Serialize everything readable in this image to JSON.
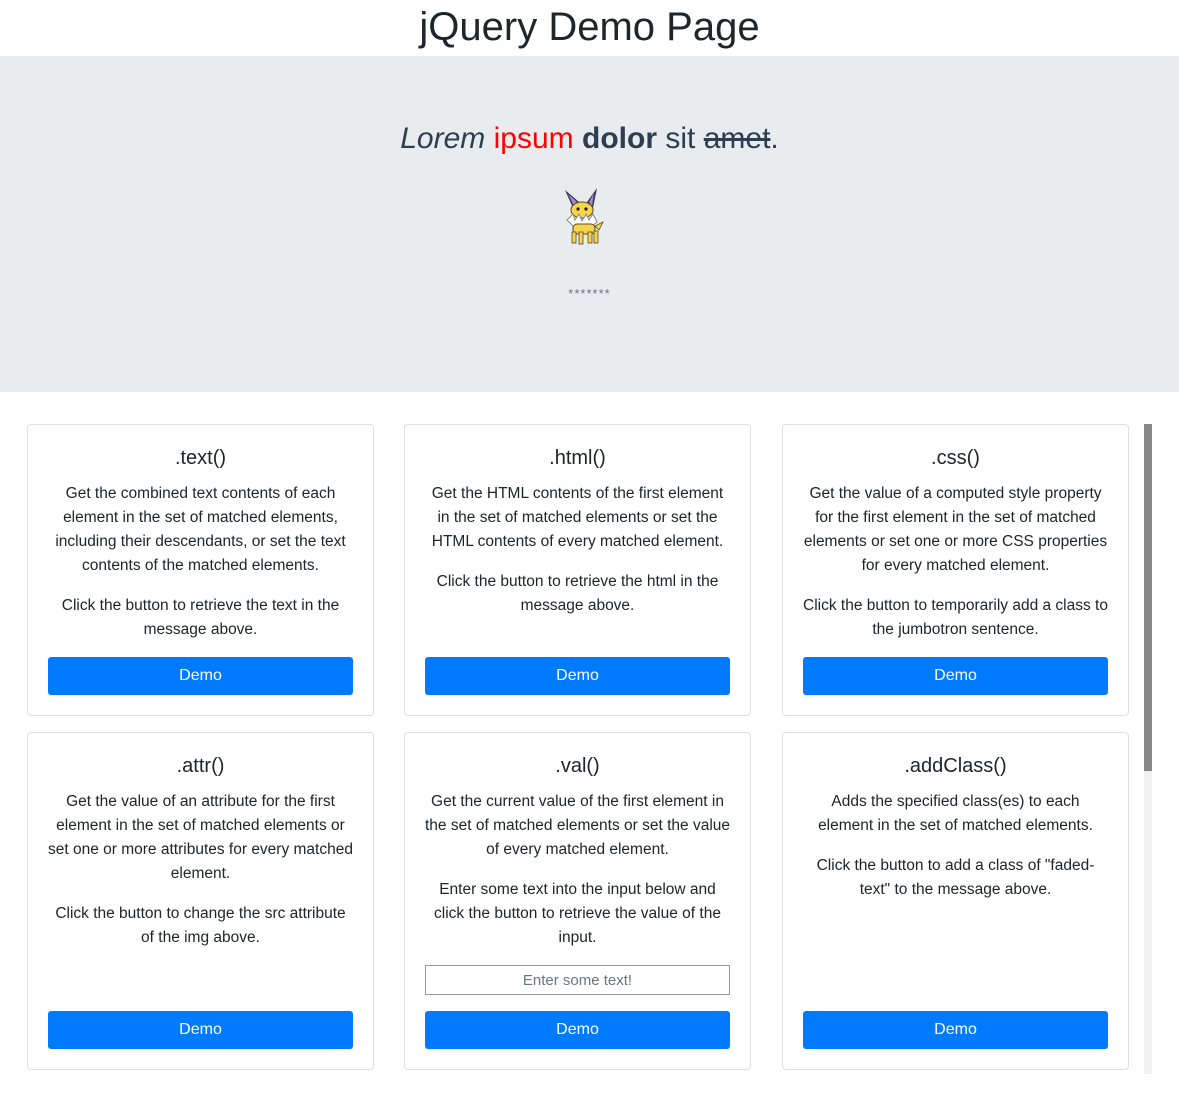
{
  "page": {
    "title": "jQuery Demo Page"
  },
  "jumbotron": {
    "sentence": {
      "w1": "Lorem",
      "w2": "ipsum",
      "w3": "dolor",
      "w4": "sit",
      "w5": "amet",
      "end": "."
    },
    "stars": "*******",
    "sprite_icon": "yellow-electric-fox-sprite"
  },
  "cards": [
    {
      "title": ".text()",
      "description": "Get the combined text contents of each element in the set of matched elements, including their descendants, or set the text contents of the matched elements.",
      "instruction": "Click the button to retrieve the text in the message above.",
      "button": "Demo"
    },
    {
      "title": ".html()",
      "description": "Get the HTML contents of the first element in the set of matched elements or set the HTML contents of every matched element.",
      "instruction": "Click the button to retrieve the html in the message above.",
      "button": "Demo"
    },
    {
      "title": ".css()",
      "description": "Get the value of a computed style property for the first element in the set of matched elements or set one or more CSS properties for every matched element.",
      "instruction": "Click the button to temporarily add a class to the jumbotron sentence.",
      "button": "Demo"
    },
    {
      "title": ".attr()",
      "description": "Get the value of an attribute for the first element in the set of matched elements or set one or more attributes for every matched element.",
      "instruction": "Click the button to change the src attribute of the img above.",
      "button": "Demo"
    },
    {
      "title": ".val()",
      "description": "Get the current value of the first element in the set of matched elements or set the value of every matched element.",
      "instruction": "Enter some text into the input below and click the button to retrieve the value of the input.",
      "input_placeholder": "Enter some text!",
      "input_value": "",
      "button": "Demo"
    },
    {
      "title": ".addClass()",
      "description": "Adds the specified class(es) to each element in the set of matched elements.",
      "instruction": "Click the button to add a class of \"faded-text\" to the message above.",
      "button": "Demo"
    }
  ],
  "colors": {
    "primary": "#007bff",
    "jumbotron_bg": "#e9ecef",
    "accent_red": "#ff0000"
  }
}
